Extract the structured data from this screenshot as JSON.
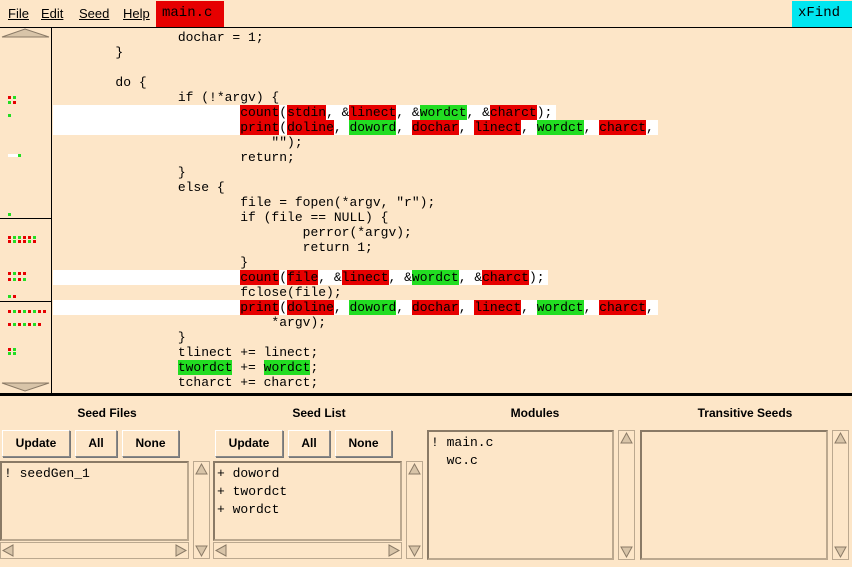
{
  "menu": {
    "file": "File",
    "edit": "Edit",
    "seed": "Seed",
    "help": "Help",
    "active_file": "main.c",
    "find": "xFind"
  },
  "colors": {
    "background": "#fde6c8",
    "highlight_red": "#e60000",
    "highlight_green": "#22dd22",
    "find_button": "#00e6f0",
    "line_marker": "#ffffff"
  },
  "code_lines": [
    [
      {
        "t": "                dochar = 1;"
      }
    ],
    [
      {
        "t": "        }"
      }
    ],
    [
      {
        "t": ""
      }
    ],
    [
      {
        "t": "        do {"
      }
    ],
    [
      {
        "t": "                if (!*argv) {"
      }
    ],
    [
      {
        "t": "                        "
      },
      {
        "t": "count",
        "h": "r"
      },
      {
        "t": "("
      },
      {
        "t": "stdin",
        "h": "r"
      },
      {
        "t": ", &"
      },
      {
        "t": "linect",
        "h": "r"
      },
      {
        "t": ", &"
      },
      {
        "t": "wordct",
        "h": "g"
      },
      {
        "t": ", &"
      },
      {
        "t": "charct",
        "h": "r"
      },
      {
        "t": ");"
      }
    ],
    [
      {
        "t": "                        "
      },
      {
        "t": "print",
        "h": "r"
      },
      {
        "t": "("
      },
      {
        "t": "doline",
        "h": "r"
      },
      {
        "t": ", "
      },
      {
        "t": "doword",
        "h": "g"
      },
      {
        "t": ", "
      },
      {
        "t": "dochar",
        "h": "r"
      },
      {
        "t": ", "
      },
      {
        "t": "linect",
        "h": "r"
      },
      {
        "t": ", "
      },
      {
        "t": "wordct",
        "h": "g"
      },
      {
        "t": ", "
      },
      {
        "t": "charct",
        "h": "r"
      },
      {
        "t": ","
      }
    ],
    [
      {
        "t": "                            \"\");"
      }
    ],
    [
      {
        "t": "                        return;"
      }
    ],
    [
      {
        "t": "                }"
      }
    ],
    [
      {
        "t": "                else {"
      }
    ],
    [
      {
        "t": "                        file = fopen(*argv, \"r\");"
      }
    ],
    [
      {
        "t": "                        if (file == NULL) {"
      }
    ],
    [
      {
        "t": "                                perror(*argv);"
      }
    ],
    [
      {
        "t": "                                return 1;"
      }
    ],
    [
      {
        "t": "                        }"
      }
    ],
    [
      {
        "t": "                        "
      },
      {
        "t": "count",
        "h": "r"
      },
      {
        "t": "("
      },
      {
        "t": "file",
        "h": "r"
      },
      {
        "t": ", &"
      },
      {
        "t": "linect",
        "h": "r"
      },
      {
        "t": ", &"
      },
      {
        "t": "wordct",
        "h": "g"
      },
      {
        "t": ", &"
      },
      {
        "t": "charct",
        "h": "r"
      },
      {
        "t": ");"
      }
    ],
    [
      {
        "t": "                        fclose(file);"
      }
    ],
    [
      {
        "t": "                        "
      },
      {
        "t": "print",
        "h": "r"
      },
      {
        "t": "("
      },
      {
        "t": "doline",
        "h": "r"
      },
      {
        "t": ", "
      },
      {
        "t": "doword",
        "h": "g"
      },
      {
        "t": ", "
      },
      {
        "t": "dochar",
        "h": "r"
      },
      {
        "t": ", "
      },
      {
        "t": "linect",
        "h": "r"
      },
      {
        "t": ", "
      },
      {
        "t": "wordct",
        "h": "g"
      },
      {
        "t": ", "
      },
      {
        "t": "charct",
        "h": "r"
      },
      {
        "t": ","
      }
    ],
    [
      {
        "t": "                            *argv);"
      }
    ],
    [
      {
        "t": "                }"
      }
    ],
    [
      {
        "t": "                tlinect += linect;"
      }
    ],
    [
      {
        "t": "                "
      },
      {
        "t": "twordct",
        "h": "g"
      },
      {
        "t": " += "
      },
      {
        "t": "wordct",
        "h": "g"
      },
      {
        "t": ";"
      }
    ],
    [
      {
        "t": "                tcharct += charct;"
      }
    ]
  ],
  "marked_lines": [
    5,
    6,
    16,
    18
  ],
  "panels": {
    "seed_files": {
      "title": "Seed Files",
      "update": "Update",
      "all": "All",
      "none": "None",
      "items": [
        "! seedGen_1"
      ]
    },
    "seed_list": {
      "title": "Seed List",
      "update": "Update",
      "all": "All",
      "none": "None",
      "items": [
        "+ doword",
        "+ twordct",
        "+ wordct"
      ]
    },
    "modules": {
      "title": "Modules",
      "items": [
        "! main.c",
        "  wc.c"
      ]
    },
    "transitive_seeds": {
      "title": "Transitive Seeds",
      "items": []
    }
  }
}
